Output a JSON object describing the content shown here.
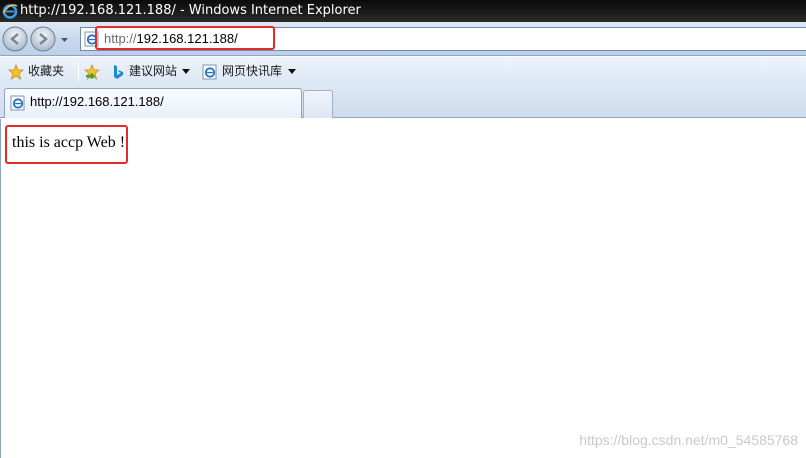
{
  "window": {
    "title": "http://192.168.121.188/ - Windows Internet Explorer"
  },
  "address_bar": {
    "protocol": "http://",
    "host": "192.168.121.188/",
    "icon": "ie-page-icon"
  },
  "favorites_bar": {
    "favorites_label": "收藏夹",
    "suggested_sites_label": "建议网站",
    "web_slice_gallery_label": "网页快讯库"
  },
  "tabs": [
    {
      "label": "http://192.168.121.188/",
      "active": true
    }
  ],
  "page": {
    "text": "this is accp Web !"
  },
  "watermark": "https://blog.csdn.net/m0_54585768",
  "colors": {
    "highlight": "#e52a2a",
    "ie_blue": "#1e73c8"
  }
}
